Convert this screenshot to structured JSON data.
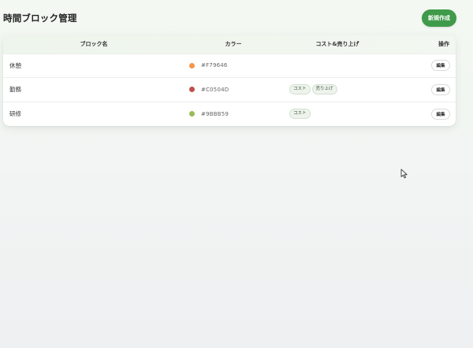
{
  "page": {
    "title": "時間ブロック管理",
    "new_button_label": "新規作成"
  },
  "table": {
    "columns": {
      "name": "ブロック名",
      "color": "カラー",
      "cost_sales": "コスト&売り上げ",
      "actions": "操作"
    },
    "rows": [
      {
        "name": "休憩",
        "color_hex": "#F79646",
        "color_swatch": "#F79646",
        "tags": [],
        "edit_label": "編集"
      },
      {
        "name": "勤務",
        "color_hex": "#C0504D",
        "color_swatch": "#C0504D",
        "tags": [
          "コスト",
          "売り上げ"
        ],
        "edit_label": "編集"
      },
      {
        "name": "研修",
        "color_hex": "#9BBB59",
        "color_swatch": "#9BBB59",
        "tags": [
          "コスト"
        ],
        "edit_label": "編集"
      }
    ]
  },
  "colors": {
    "primary_button": "#3f9a4a"
  },
  "icons": {
    "cursor": "mouse-pointer-icon"
  }
}
